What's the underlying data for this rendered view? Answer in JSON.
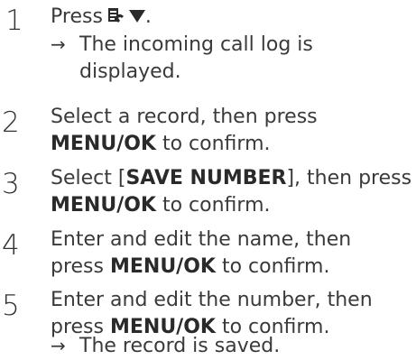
{
  "steps": [
    {
      "number": "1",
      "text": "Press",
      "after_icons": ".",
      "icons": [
        "call-log-key-icon",
        "down-triangle-icon"
      ],
      "result_arrow": "→",
      "result_line1": "The incoming call log is",
      "result_line2": "displayed."
    },
    {
      "number": "2",
      "line1": "Select a record, then press",
      "bold": "MENU/OK",
      "line2_rest": " to confirm."
    },
    {
      "number": "3",
      "line1_pre": "Select [",
      "line1_bold": "SAVE NUMBER",
      "line1_post": "], then press",
      "bold": "MENU/OK",
      "line2_rest": " to confirm."
    },
    {
      "number": "4",
      "line1": "Enter and edit the name, then",
      "line2_pre": "press ",
      "bold": "MENU/OK",
      "line2_rest": " to confirm."
    },
    {
      "number": "5",
      "line1": "Enter and edit the number, then",
      "line2_pre": "press ",
      "bold": "MENU/OK",
      "line2_rest": " to confirm.",
      "result_arrow": "→",
      "result_line1": "The record is saved."
    }
  ]
}
